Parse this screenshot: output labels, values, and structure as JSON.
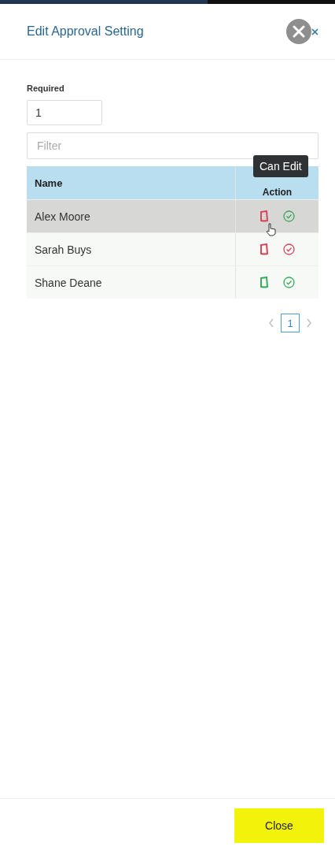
{
  "window": {
    "title": "Edit Approval Setting"
  },
  "required": {
    "label": "Required",
    "value": "1"
  },
  "filter": {
    "placeholder": "Filter"
  },
  "table": {
    "columns": [
      "Name",
      "Action"
    ],
    "rows": [
      {
        "name": "Alex Moore",
        "can_edit": false,
        "approved": true,
        "highlighted": true
      },
      {
        "name": "Sarah Buys",
        "can_edit": false,
        "approved": false,
        "highlighted": false
      },
      {
        "name": "Shane Deane",
        "can_edit": true,
        "approved": true,
        "highlighted": false
      }
    ]
  },
  "tooltip": {
    "text": "Can Edit"
  },
  "pagination": {
    "pages": [
      {
        "label": "1",
        "selected": true
      }
    ]
  },
  "footer": {
    "close": "Close"
  }
}
